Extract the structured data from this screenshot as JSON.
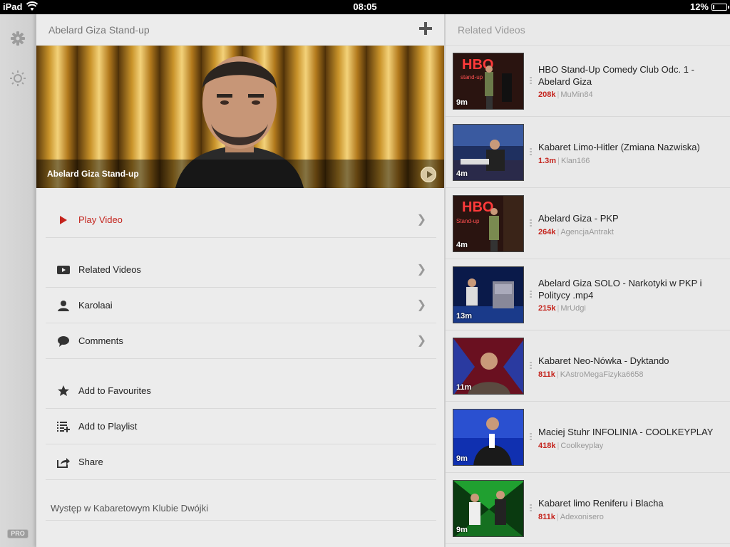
{
  "statusbar": {
    "device": "iPad",
    "time": "08:05",
    "battery": "12%",
    "battery_level": 0.12
  },
  "rail": {
    "pro_label": "PRO"
  },
  "main": {
    "title": "Abelard Giza Stand-up",
    "hero_caption": "Abelard Giza Stand-up",
    "menu": [
      {
        "label": "Play Video",
        "icon": "play-icon"
      },
      {
        "label": "Related Videos",
        "icon": "youtube-icon"
      },
      {
        "label": "Karolaai",
        "icon": "user-icon"
      },
      {
        "label": "Comments",
        "icon": "comment-icon"
      },
      {
        "label": "Add to Favourites",
        "icon": "star-icon"
      },
      {
        "label": "Add to Playlist",
        "icon": "playlist-add-icon"
      },
      {
        "label": "Share",
        "icon": "share-icon"
      }
    ],
    "description": "Występ w Kabaretowym Klubie Dwójki"
  },
  "side": {
    "title": "Related Videos",
    "videos": [
      {
        "title": "HBO Stand-Up Comedy Club Odc. 1 - Abelard Giza",
        "views": "208k",
        "channel": "MuMin84",
        "duration": "9m"
      },
      {
        "title": "Kabaret Limo-Hitler (Zmiana Nazwiska)",
        "views": "1.3m",
        "channel": "Klan166",
        "duration": "4m"
      },
      {
        "title": "Abelard Giza - PKP",
        "views": "264k",
        "channel": "AgencjaAntrakt",
        "duration": "4m"
      },
      {
        "title": "Abelard Giza SOLO - Narkotyki w PKP i Politycy .mp4",
        "views": "215k",
        "channel": "MrUdgi",
        "duration": "13m"
      },
      {
        "title": "Kabaret Neo-Nówka -  Dyktando",
        "views": "811k",
        "channel": "KAstroMegaFizyka6658",
        "duration": "11m"
      },
      {
        "title": "Maciej Stuhr INFOLINIA - COOLKEYPLAY",
        "views": "418k",
        "channel": "Coolkeyplay",
        "duration": "9m"
      },
      {
        "title": "Kabaret limo Reniferu i Blacha",
        "views": "811k",
        "channel": "Adexonisero",
        "duration": "9m"
      }
    ]
  }
}
